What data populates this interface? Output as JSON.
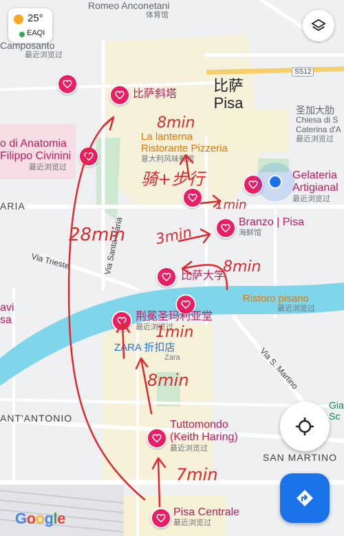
{
  "weather": {
    "temp": "25°",
    "aqi": "EAQI"
  },
  "city": {
    "zh": "比萨",
    "en": "Pisa"
  },
  "places": {
    "leaning_tower": "比萨斜塔",
    "la_lanterna": {
      "name": "La lanterna",
      "name2": "Ristorante Pizzeria",
      "sub": "意大利风味餐馆"
    },
    "branzo": {
      "name": "Branzo | Pisa",
      "sub": "海鲜馆"
    },
    "university": "比萨大学",
    "santa_maria": {
      "name": "荆冕圣玛利亚堂",
      "sub": "最近浏览过"
    },
    "tuttomondo": {
      "name": "Tuttomondo",
      "name2": "(Keith Haring)",
      "sub": "最近浏览过"
    },
    "pisa_centrale": {
      "name": "Pisa Centrale",
      "sub": "最近浏览过"
    },
    "gelateria": {
      "name": "Gelateria",
      "name2": "Artigianal",
      "sub": "最近浏览过"
    },
    "ristoro": {
      "name": "Ristoro pisano",
      "sub": "最近浏览过"
    },
    "camposanto": {
      "name": "Camposanto",
      "sub": "最近浏览过"
    },
    "anatomia": {
      "name": "o di Anatomia",
      "name2": "Filippo Civinini",
      "sub": "最近浏览过"
    },
    "chiesa": {
      "name": "圣加大肋",
      "name2": "Chiesa di S",
      "name3": "Caterina d'A",
      "sub": "最近浏览过"
    },
    "romeo": "Romeo Anconetani",
    "stadium_sub": "体育馆",
    "zara": {
      "name": "ZARA 折扣店",
      "sub": "Zara"
    },
    "avi": {
      "name": "avi",
      "name2": "sa"
    },
    "gia": {
      "name": "Gia",
      "name2": "Sc"
    }
  },
  "streets": {
    "ss12": "SS12",
    "via_trieste": "Via Trieste",
    "via_santa_maria": "Via Santa Maria",
    "via_s_martino": "Via S. Martino",
    "san_martino": "SAN MARTINO",
    "sant_antonio": "ANT'ANTONIO",
    "aria": "ARIA"
  },
  "annotations": {
    "a8min_top": "8min",
    "walk_note": "骑+步行",
    "a1min_top": "1min",
    "a3min": "3min",
    "a28min": "28min",
    "a8min_mid": "8min",
    "a1min_mid": "1min",
    "a8min_low": "8min",
    "a7min": "7min"
  },
  "icons": {
    "layers": "layers-icon",
    "locate": "crosshair-icon",
    "directions": "directions-icon",
    "favorite": "heart-icon"
  },
  "colors": {
    "accent": "#1a73e8",
    "pin": "#e91e63",
    "river": "#7fd6ea",
    "ink": "#e3262a"
  },
  "logo": "Google"
}
